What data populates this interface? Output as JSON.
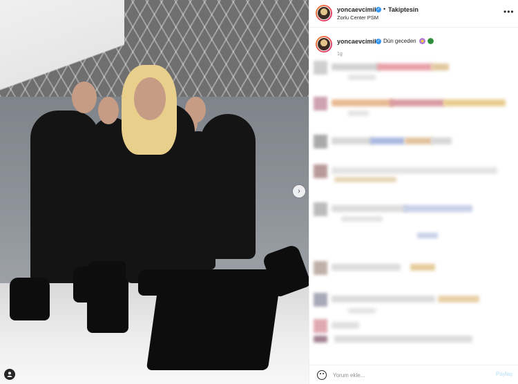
{
  "post": {
    "username": "yoncaevcimik",
    "follow_status": "Takiptesin",
    "location": "Zorlu Center PSM",
    "caption": "Dün geceden",
    "time_ago": "1g"
  },
  "photo": {
    "alt": "Grup fotoğrafı"
  },
  "comment_box": {
    "placeholder": "Yorum ekle...",
    "share_label": "Paylaş"
  },
  "icons": {
    "verified": "verified-badge-icon",
    "more": "more-options-icon",
    "next": "chevron-right-icon",
    "emoji": "smile-icon",
    "user_tag": "user-tag-icon"
  },
  "colors": {
    "verified": "#3897f0",
    "share_disabled": "#b2dffc",
    "meta_text": "#8e8e8e"
  }
}
